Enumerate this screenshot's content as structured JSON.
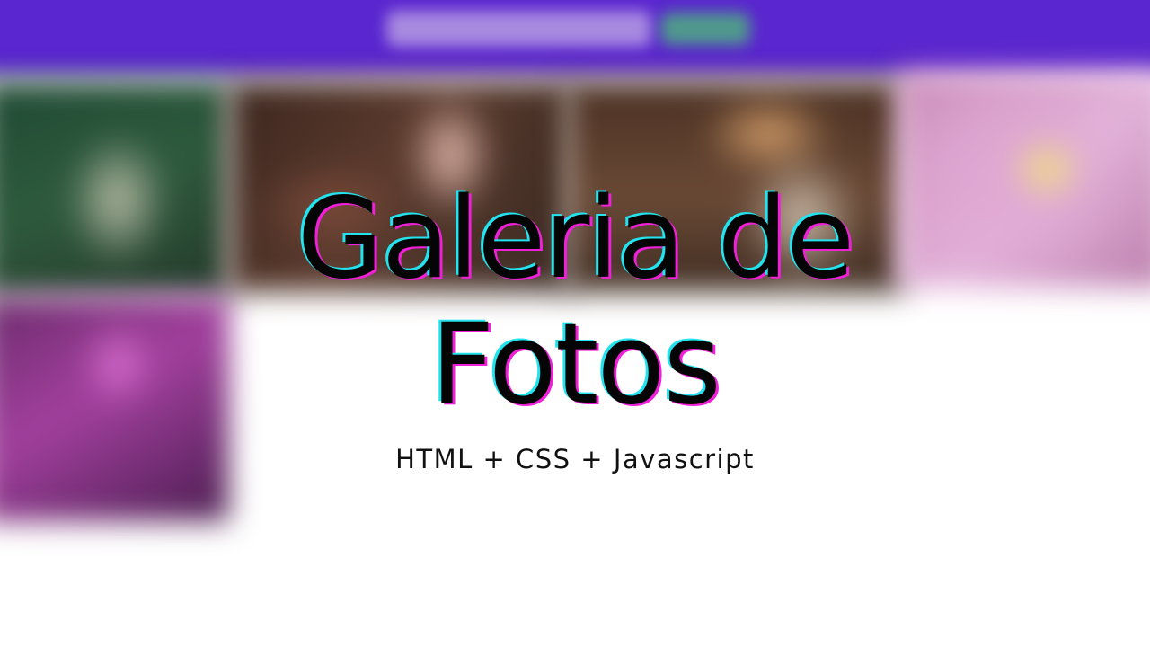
{
  "title": {
    "line1": "Galeria de",
    "line2": "Fotos"
  },
  "subtitle": "HTML + CSS + Javascript",
  "colors": {
    "header_purple": "#5a26cf",
    "title_text": "#050505",
    "title_shadow_cyan": "#23e3ee",
    "title_shadow_magenta": "#f01fd8",
    "background": "#ffffff"
  }
}
